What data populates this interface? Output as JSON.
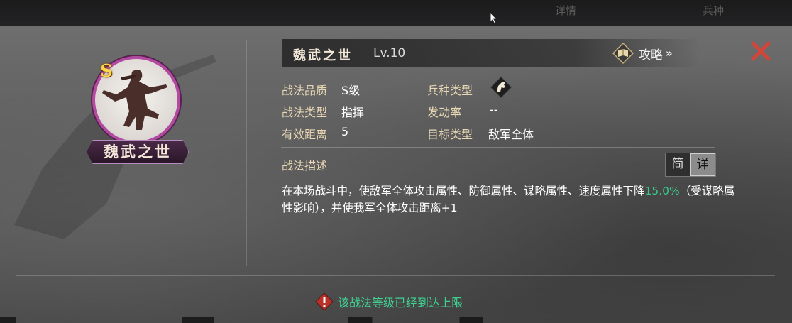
{
  "topbar": {
    "tabs": [
      "详情",
      "兵种"
    ]
  },
  "portrait": {
    "grade_badge": "S",
    "name_plate": "魏武之世",
    "frame_color": "#b24aa2"
  },
  "header": {
    "skill_name": "魏武之世",
    "level": "Lv.10",
    "guide_label": "攻略",
    "guide_arrow": "»"
  },
  "attributes": {
    "quality_label": "战法品质",
    "quality_value": "S级",
    "type_label": "战法类型",
    "type_value": "指挥",
    "range_label": "有效距离",
    "range_value": "5",
    "troop_label": "兵种类型",
    "troop_icon": "horse-icon",
    "trigger_label": "发动率",
    "trigger_value": "--",
    "target_label": "目标类型",
    "target_value": "敌军全体"
  },
  "description": {
    "label": "战法描述",
    "toggle_simple": "简",
    "toggle_detail": "详",
    "active_toggle": "详",
    "text_before": "在本场战斗中，使敌军全体攻击属性、防御属性、谋略属性、速度属性下降",
    "highlight": "15.0%",
    "text_after": "（受谋略属性影响），并使我军全体攻击距离+1",
    "highlight_color": "#39c98a"
  },
  "notice": {
    "text": "该战法等级已经到达上限",
    "color": "#3fd191"
  }
}
